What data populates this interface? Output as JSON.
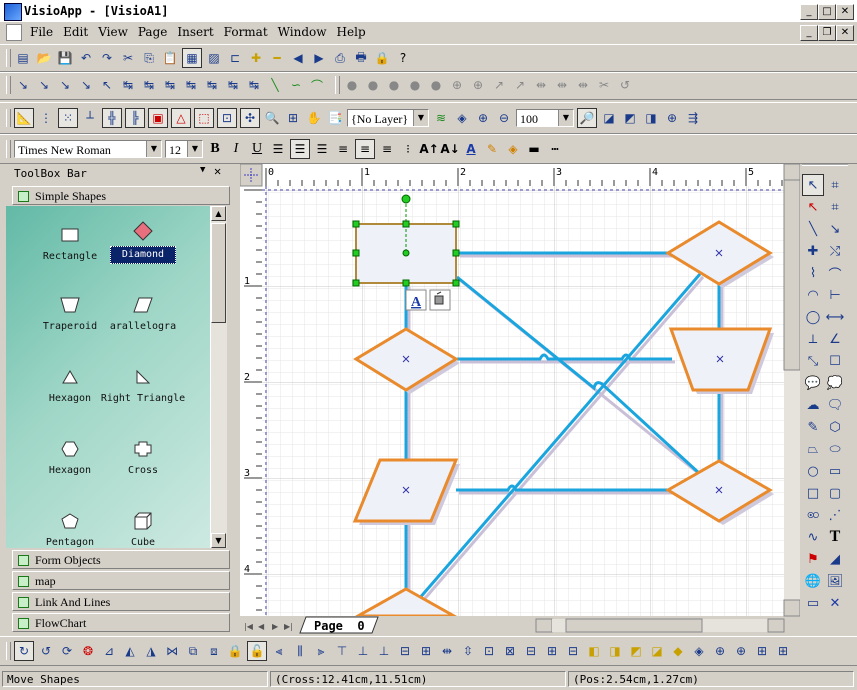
{
  "window": {
    "title": "VisioApp - [VisioA1]"
  },
  "menu": [
    "File",
    "Edit",
    "View",
    "Page",
    "Insert",
    "Format",
    "Window",
    "Help"
  ],
  "toolbar": {
    "layer_combo": "{No Layer}",
    "zoom_combo": "100",
    "font_combo": "Times New Roman",
    "size_combo": "12",
    "bold_label": "B",
    "italic_label": "I",
    "underline_label": "U"
  },
  "toolbox": {
    "title": "ToolBox Bar",
    "active_category": "Simple Shapes",
    "shapes": [
      {
        "label": "Rectangle",
        "icon": "rectangle-icon"
      },
      {
        "label": "Diamond",
        "icon": "diamond-icon",
        "selected": true
      },
      {
        "label": "Traperoid",
        "icon": "trapezoid-icon"
      },
      {
        "label": "arallelogra",
        "icon": "parallelogram-icon"
      },
      {
        "label": "Hexagon",
        "icon": "triangle-icon"
      },
      {
        "label": "Right Triangle",
        "icon": "right-triangle-icon"
      },
      {
        "label": "Hexagon",
        "icon": "hexagon-icon"
      },
      {
        "label": "Cross",
        "icon": "cross-icon"
      },
      {
        "label": "Pentagon",
        "icon": "pentagon-icon"
      },
      {
        "label": "Cube",
        "icon": "cube-icon"
      }
    ],
    "categories": [
      "Form Objects",
      "map",
      "Link And Lines",
      "FlowChart"
    ]
  },
  "ruler": {
    "h_ticks": [
      "0",
      "1",
      "2",
      "3",
      "4",
      "5"
    ],
    "v_ticks": [
      "1",
      "2",
      "3",
      "4"
    ]
  },
  "page_tab": {
    "label": "Page",
    "number": "0"
  },
  "status": {
    "message": "Move Shapes",
    "cross": "(Cross:12.41cm,11.51cm)",
    "pos": "(Pos:2.54cm,1.27cm)"
  },
  "colors": {
    "shape_stroke": "#e98a2c",
    "shape_fill": "#eef1f7",
    "connector": "#1aa5de",
    "selection": "#009900",
    "toolbox_bg": "#62b9a6"
  }
}
